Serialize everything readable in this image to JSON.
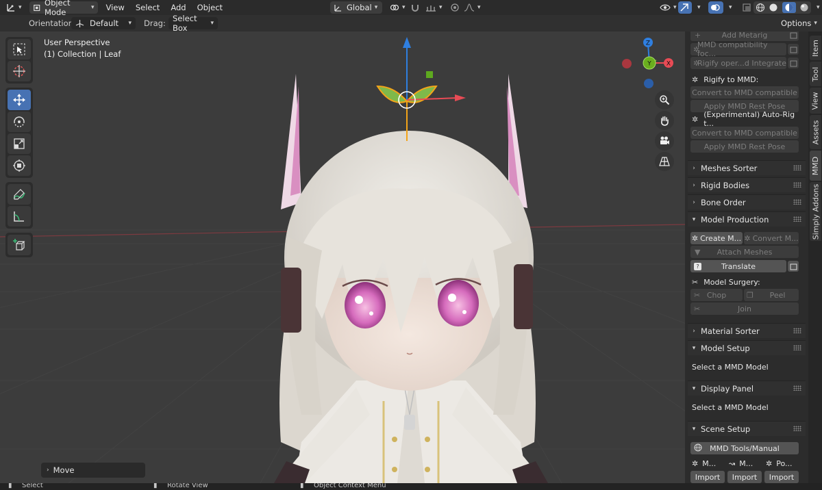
{
  "header": {
    "mode": "Object Mode",
    "menus": [
      "View",
      "Select",
      "Add",
      "Object"
    ],
    "transform_orientation": "Global"
  },
  "tool_header": {
    "orientation_label": "Orientation:",
    "orientation_value": "Default",
    "drag_label": "Drag:",
    "drag_value": "Select Box",
    "options_label": "Options"
  },
  "viewport": {
    "perspective": "User Perspective",
    "collection": "(1) Collection | Leaf",
    "gizmo_axes": {
      "z": "Z",
      "y": "Y",
      "x": "X"
    },
    "last_operator": "Move"
  },
  "sidebar": {
    "add_metarig": "Add Metarig",
    "mmd_compat": "MMD compatibility foc...",
    "rigify_integrate": "Rigify oper...d Integrate",
    "rigify_to_mmd": "Rigify to MMD:",
    "convert_mmd_1": "Convert to MMD compatible",
    "apply_rest_1": "Apply MMD Rest Pose",
    "auto_rig": "(Experimental) Auto-Rig t...",
    "convert_mmd_2": "Convert to MMD compatible",
    "apply_rest_2": "Apply MMD Rest Pose",
    "panels": {
      "meshes_sorter": "Meshes Sorter",
      "rigid_bodies": "Rigid Bodies",
      "bone_order": "Bone Order",
      "model_production": "Model Production",
      "material_sorter": "Material Sorter",
      "model_setup": "Model Setup",
      "display_panel": "Display Panel",
      "scene_setup": "Scene Setup"
    },
    "create_model": "Create M...",
    "convert_model": "Convert M...",
    "attach_meshes": "Attach Meshes",
    "translate": "Translate",
    "model_surgery": "Model Surgery:",
    "chop": "Chop",
    "peel": "Peel",
    "join": "Join",
    "model_setup_msg": "Select a MMD Model",
    "display_panel_msg": "Select a MMD Model",
    "tools_manual": "MMD Tools/Manual",
    "import_labels": [
      "M...",
      "M...",
      "Po..."
    ],
    "import_button": "Import"
  },
  "tabs": [
    "Item",
    "Tool",
    "View",
    "Assets",
    "MMD",
    "Simply Addons"
  ],
  "status": {
    "select": "Select",
    "rotate": "Rotate View",
    "context": "Object Context Menu"
  },
  "colors": {
    "active_tool": "#4772b3",
    "axis_x": "#e84b55",
    "axis_y": "#6aae1e",
    "axis_z": "#2f7fe0"
  }
}
